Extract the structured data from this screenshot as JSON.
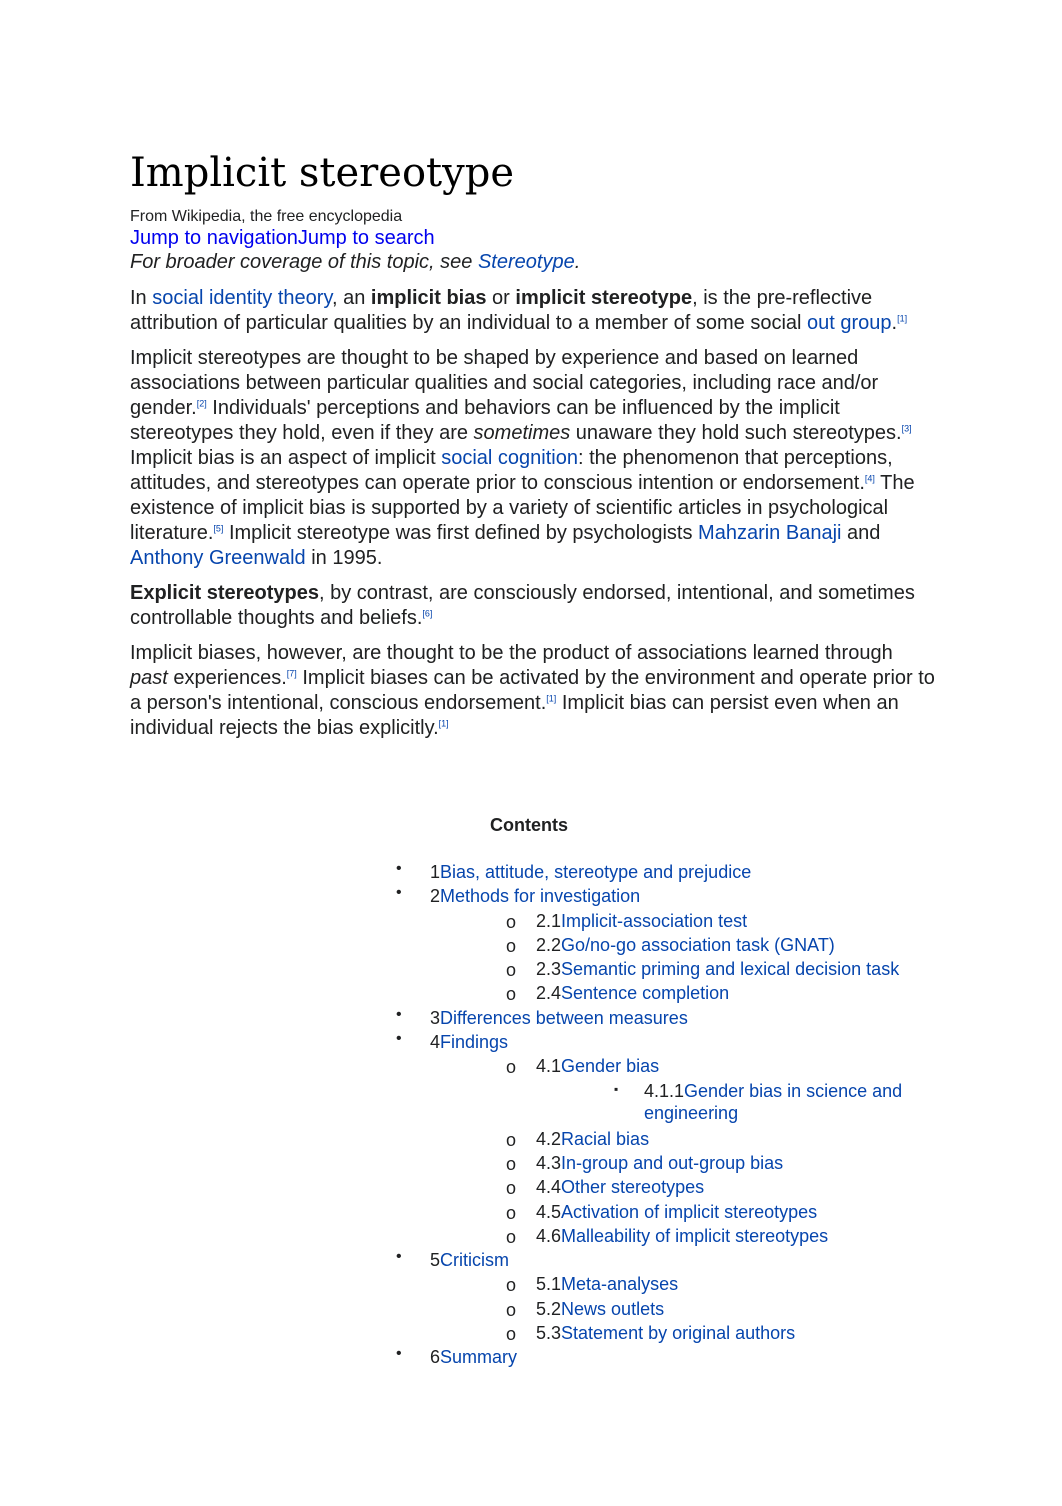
{
  "title": "Implicit stereotype",
  "tagline": "From Wikipedia, the free encyclopedia",
  "jump_navigation": "Jump to navigation",
  "jump_search": "Jump to search",
  "hatnote": [
    {
      "t": "For broader coverage of this topic, see "
    },
    {
      "t": "Stereotype",
      "s": "a"
    },
    {
      "t": "."
    }
  ],
  "paragraphs": [
    [
      {
        "t": "In "
      },
      {
        "t": "social identity theory",
        "s": "a"
      },
      {
        "t": ", an "
      },
      {
        "t": "implicit bias",
        "s": "b"
      },
      {
        "t": " or "
      },
      {
        "t": "implicit stereotype",
        "s": "b"
      },
      {
        "t": ", is the pre-reflective attribution of particular qualities by an individual to a member of some social "
      },
      {
        "t": "out group",
        "s": "a"
      },
      {
        "t": "."
      },
      {
        "t": "[1]",
        "s": "sup"
      }
    ],
    [
      {
        "t": "Implicit stereotypes are thought to be shaped by experience and based on learned associations between particular qualities and social categories, including race and/or gender."
      },
      {
        "t": "[2]",
        "s": "sup"
      },
      {
        "t": " Individuals' perceptions and behaviors can be influenced by the implicit stereotypes they hold, even if they are "
      },
      {
        "t": "sometimes",
        "s": "i"
      },
      {
        "t": " unaware they hold such stereotypes."
      },
      {
        "t": "[3]",
        "s": "sup"
      },
      {
        "t": " Implicit bias is an aspect of implicit "
      },
      {
        "t": "social cognition",
        "s": "a"
      },
      {
        "t": ": the phenomenon that perceptions, attitudes, and stereotypes can operate prior to conscious intention or endorsement."
      },
      {
        "t": "[4]",
        "s": "sup"
      },
      {
        "t": " The existence of implicit bias is supported by a variety of scientific articles in psychological literature."
      },
      {
        "t": "[5]",
        "s": "sup"
      },
      {
        "t": " Implicit stereotype was first defined by psychologists "
      },
      {
        "t": "Mahzarin Banaji",
        "s": "a"
      },
      {
        "t": " and "
      },
      {
        "t": "Anthony Greenwald",
        "s": "a"
      },
      {
        "t": " in 1995."
      }
    ],
    [
      {
        "t": "Explicit stereotypes",
        "s": "b"
      },
      {
        "t": ", by contrast, are consciously endorsed, intentional, and sometimes controllable thoughts and beliefs."
      },
      {
        "t": "[6]",
        "s": "sup"
      }
    ],
    [
      {
        "t": "Implicit biases, however, are thought to be the product of associations learned through "
      },
      {
        "t": "past",
        "s": "i"
      },
      {
        "t": " experiences."
      },
      {
        "t": "[7]",
        "s": "sup"
      },
      {
        "t": " Implicit biases can be activated by the environment and operate prior to a person's intentional, conscious endorsement."
      },
      {
        "t": "[1]",
        "s": "sup"
      },
      {
        "t": " Implicit bias can persist even when an individual rejects the bias explicitly."
      },
      {
        "t": "[1]",
        "s": "sup"
      }
    ]
  ],
  "toc": {
    "title": "Contents",
    "items": [
      {
        "level": 1,
        "num": "1",
        "label": "Bias, attitude, stereotype and prejudice"
      },
      {
        "level": 1,
        "num": "2",
        "label": "Methods for investigation"
      },
      {
        "level": 2,
        "num": "2.1",
        "label": "Implicit-association test"
      },
      {
        "level": 2,
        "num": "2.2",
        "label": "Go/no-go association task (GNAT)"
      },
      {
        "level": 2,
        "num": "2.3",
        "label": "Semantic priming and lexical decision task"
      },
      {
        "level": 2,
        "num": "2.4",
        "label": "Sentence completion"
      },
      {
        "level": 1,
        "num": "3",
        "label": "Differences between measures"
      },
      {
        "level": 1,
        "num": "4",
        "label": "Findings"
      },
      {
        "level": 2,
        "num": "4.1",
        "label": "Gender bias"
      },
      {
        "level": 3,
        "num": "4.1.1",
        "label": "Gender bias in science and",
        "label2": "engineering"
      },
      {
        "level": 2,
        "num": "4.2",
        "label": "Racial bias"
      },
      {
        "level": 2,
        "num": "4.3",
        "label": "In-group and out-group bias"
      },
      {
        "level": 2,
        "num": "4.4",
        "label": "Other stereotypes"
      },
      {
        "level": 2,
        "num": "4.5",
        "label": "Activation of implicit stereotypes"
      },
      {
        "level": 2,
        "num": "4.6",
        "label": "Malleability of implicit stereotypes"
      },
      {
        "level": 1,
        "num": "5",
        "label": "Criticism"
      },
      {
        "level": 2,
        "num": "5.1",
        "label": "Meta-analyses"
      },
      {
        "level": 2,
        "num": "5.2",
        "label": "News outlets"
      },
      {
        "level": 2,
        "num": "5.3",
        "label": "Statement by original authors"
      },
      {
        "level": 1,
        "num": "6",
        "label": "Summary"
      }
    ]
  }
}
